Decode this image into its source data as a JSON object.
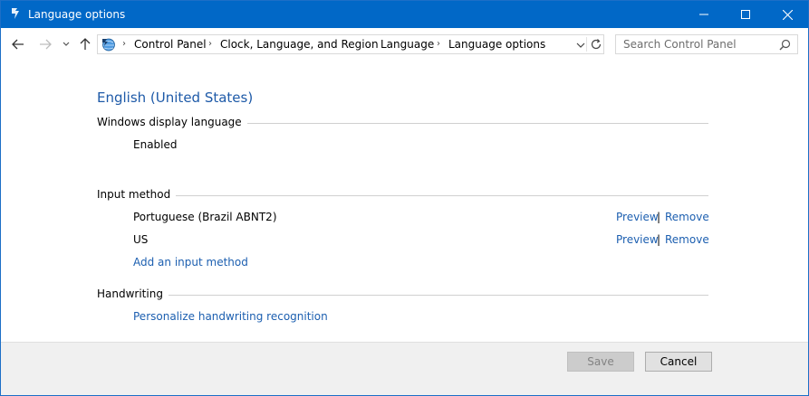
{
  "window": {
    "title": "Language options"
  },
  "nav": {
    "breadcrumbs": [
      "Control Panel",
      "Clock, Language, and Region",
      "Language",
      "Language options"
    ],
    "search_placeholder": "Search Control Panel"
  },
  "content": {
    "language_name": "English (United States)",
    "display_language": {
      "heading": "Windows display language",
      "status": "Enabled"
    },
    "input_method": {
      "heading": "Input method",
      "methods": [
        {
          "name": "Portuguese (Brazil ABNT2)",
          "preview": "Preview",
          "separator": "|",
          "remove": "Remove"
        },
        {
          "name": "US",
          "preview": "Preview",
          "separator": "|",
          "remove": "Remove"
        }
      ],
      "add_link": "Add an input method"
    },
    "handwriting": {
      "heading": "Handwriting",
      "personalize_link": "Personalize handwriting recognition"
    }
  },
  "footer": {
    "save_label": "Save",
    "cancel_label": "Cancel"
  },
  "colors": {
    "titlebar": "#0168c7",
    "link": "#1c5fb0",
    "heading": "#1e5aa8"
  }
}
